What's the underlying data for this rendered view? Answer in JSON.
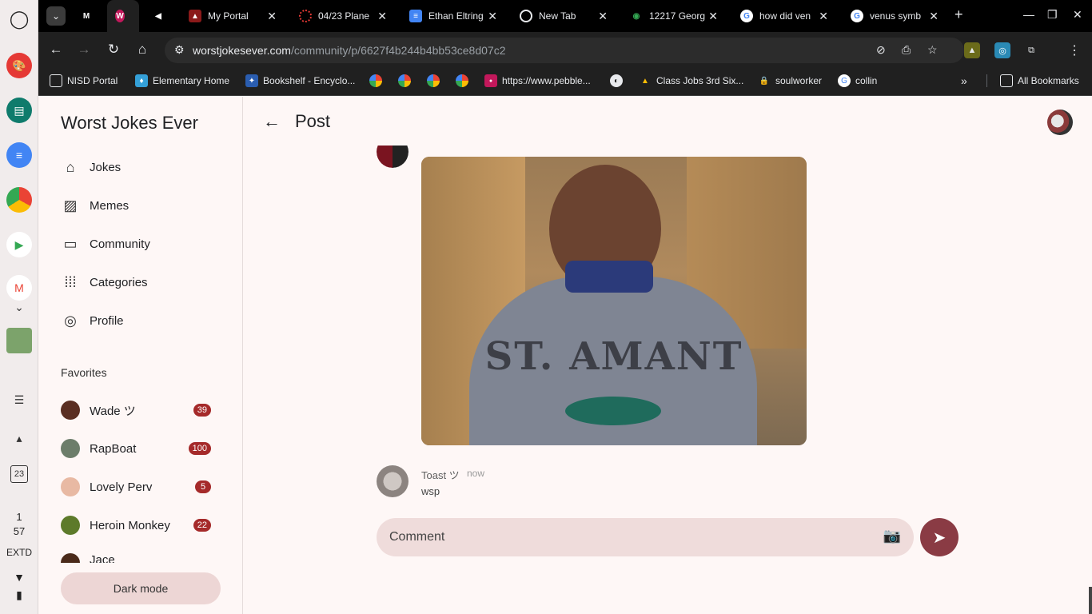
{
  "browser": {
    "tabs": [
      {
        "title": "",
        "favicon": "m-icon"
      },
      {
        "title": "",
        "favicon": "w-icon",
        "active": true
      },
      {
        "title": "",
        "favicon": "speaker-icon"
      },
      {
        "title": "My Portal",
        "favicon": "portal-icon"
      },
      {
        "title": "04/23 Plane",
        "favicon": "circle-icon"
      },
      {
        "title": "Ethan Eltring",
        "favicon": "docs-icon"
      },
      {
        "title": "New Tab",
        "favicon": "chrome-icon"
      },
      {
        "title": "12217 Georg",
        "favicon": "maps-icon"
      },
      {
        "title": "how did ven",
        "favicon": "google-icon"
      },
      {
        "title": "venus symb",
        "favicon": "google-icon"
      }
    ],
    "url_domain": "worstjokesever.com",
    "url_path": "/community/p/6627f4b244b4bb53ce8d07c2",
    "bookmarks": [
      {
        "label": "NISD Portal"
      },
      {
        "label": "Elementary Home"
      },
      {
        "label": "Bookshelf - Encyclo..."
      },
      {
        "label": "https://www.pebble..."
      },
      {
        "label": "Class Jobs 3rd Six..."
      },
      {
        "label": "soulworker"
      },
      {
        "label": "collin"
      }
    ],
    "all_bookmarks": "All Bookmarks"
  },
  "shelf": {
    "clock_hour": "1",
    "clock_min": "57",
    "extd": "EXTD",
    "calendar_day": "23"
  },
  "sidebar": {
    "title": "Worst Jokes Ever",
    "nav": [
      {
        "label": "Jokes",
        "icon": "home-icon"
      },
      {
        "label": "Memes",
        "icon": "image-icon"
      },
      {
        "label": "Community",
        "icon": "forum-icon"
      },
      {
        "label": "Categories",
        "icon": "grid-icon"
      },
      {
        "label": "Profile",
        "icon": "profile-icon"
      }
    ],
    "favorites_heading": "Favorites",
    "favorites": [
      {
        "name": "Wade ツ",
        "count": "39",
        "color": "#5a2e22"
      },
      {
        "name": "RapBoat",
        "count": "100",
        "color": "#6c7d6a"
      },
      {
        "name": "Lovely Perv",
        "count": "5",
        "color": "#e8b9a3"
      },
      {
        "name": "Heroin Monkey",
        "count": "22",
        "color": "#5d7a2a"
      },
      {
        "name": "Jace",
        "count": "",
        "color": "#4a2a1a"
      }
    ],
    "dark_mode": "Dark mode"
  },
  "main": {
    "header_title": "Post",
    "comment": {
      "author": "Toast ツ",
      "time": "now",
      "text": "wsp"
    },
    "shirt_text": "ST. AMANT",
    "input_placeholder": "Comment"
  },
  "colors": {
    "accent": "#8a3b44",
    "badge": "#a52a2a",
    "page_bg": "#fef7f6"
  }
}
